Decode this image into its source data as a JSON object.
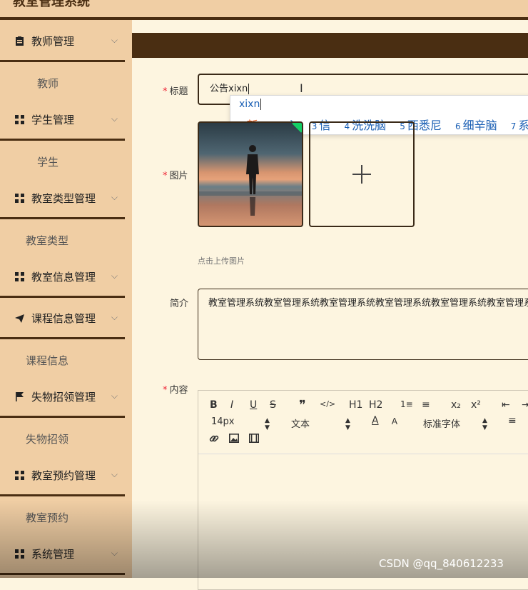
{
  "app": {
    "title": "教室管理系统"
  },
  "sidebar": {
    "items": [
      {
        "label": "教师管理",
        "icon": "clipboard-icon",
        "expanded": true
      },
      {
        "label": "教师"
      },
      {
        "label": "学生管理",
        "icon": "grid-icon",
        "expanded": true
      },
      {
        "label": "学生"
      },
      {
        "label": "教室类型管理",
        "icon": "grid-icon",
        "expanded": true
      },
      {
        "label": "教室类型"
      },
      {
        "label": "教室信息管理",
        "icon": "grid-icon",
        "expanded": false
      },
      {
        "label": "课程信息管理",
        "icon": "paper-plane-icon",
        "expanded": true
      },
      {
        "label": "课程信息"
      },
      {
        "label": "失物招领管理",
        "icon": "flag-icon",
        "expanded": true
      },
      {
        "label": "失物招领"
      },
      {
        "label": "教室预约管理",
        "icon": "grid-icon",
        "expanded": true
      },
      {
        "label": "教室预约"
      },
      {
        "label": "系统管理",
        "icon": "grid-icon",
        "expanded": false
      }
    ]
  },
  "form": {
    "title_label": "标题",
    "title_value": "公告xixn",
    "image_label": "图片",
    "image_hint": "点击上传图片",
    "intro_label": "简介",
    "intro_value": "教室管理系统教室管理系统教室管理系统教室管理系统教室管理系统教室管理系统教室",
    "content_label": "内容",
    "required_mark": "*"
  },
  "ime": {
    "composition": "xixn",
    "candidates": [
      {
        "n": "1",
        "text": "新"
      },
      {
        "n": "2",
        "text": "心"
      },
      {
        "n": "3",
        "text": "信"
      },
      {
        "n": "4",
        "text": "洗洗脑"
      },
      {
        "n": "5",
        "text": "西悉尼"
      },
      {
        "n": "6",
        "text": "细辛脑"
      },
      {
        "n": "7",
        "text": "系"
      }
    ]
  },
  "editor": {
    "buttons": [
      "B",
      "I",
      "U",
      "S",
      "❞",
      "</>",
      "H1",
      "H2",
      "1≡",
      "≡",
      "x₂",
      "x²",
      "⇤",
      "⇥"
    ],
    "font_size": "14px",
    "header_select": "文本",
    "font_family": "标准字体"
  },
  "watermark": "CSDN @qq_840612233",
  "colors": {
    "sidebar": "#f0cea4",
    "accent_dark": "#4a2e12",
    "page_bg": "#fdf5e0",
    "required": "#ee2233"
  }
}
